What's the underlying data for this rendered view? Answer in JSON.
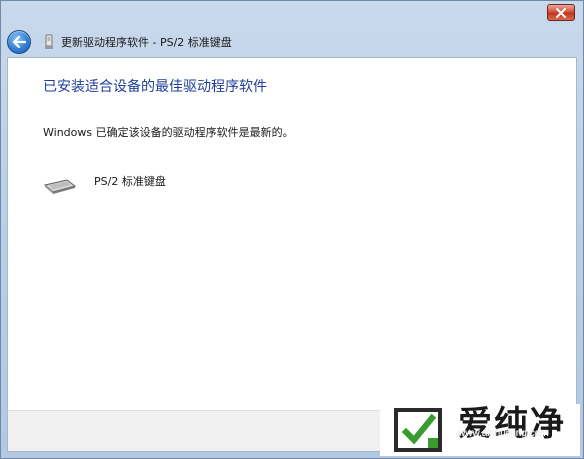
{
  "navbar": {
    "title": "更新驱动程序软件 - PS/2 标准键盘"
  },
  "content": {
    "heading": "已安装适合设备的最佳驱动程序软件",
    "message": "Windows 已确定该设备的驱动程序软件是最新的。",
    "device_name": "PS/2 标准键盘"
  },
  "watermark": {
    "brand": "爱纯净",
    "url": "www.aichunjing.com"
  },
  "colors": {
    "heading": "#1f3f9a",
    "brand_green": "#3a9b2f",
    "close_red": "#c0361f"
  }
}
